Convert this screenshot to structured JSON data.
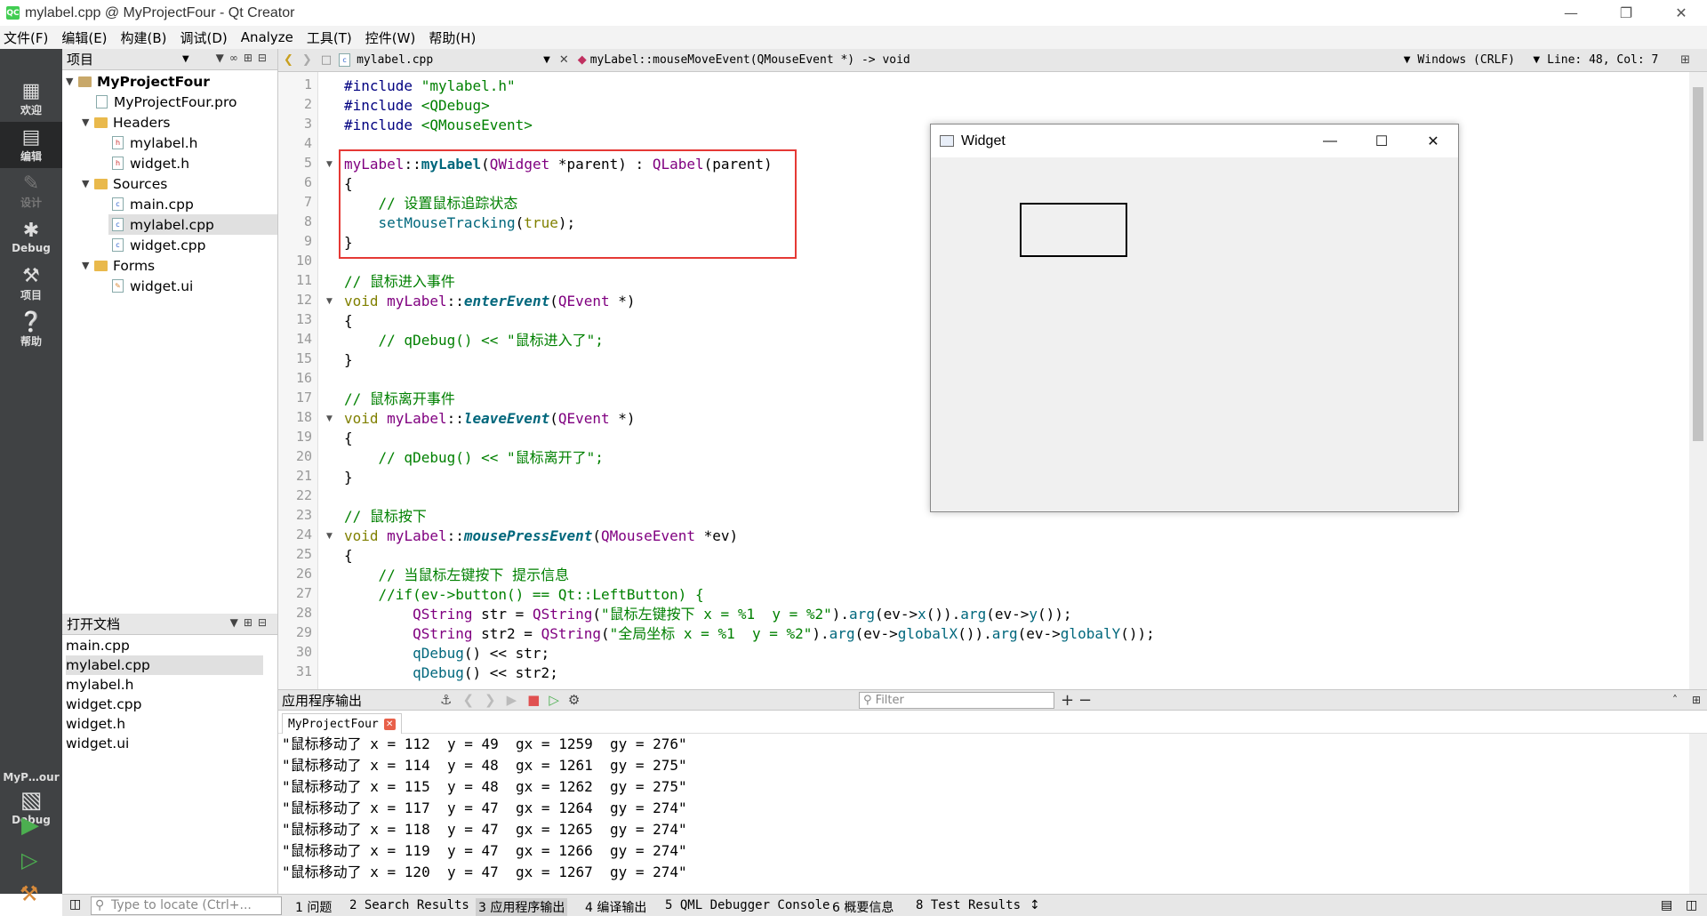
{
  "window": {
    "title": "mylabel.cpp @ MyProjectFour - Qt Creator",
    "logo": "QC"
  },
  "menu": [
    "文件(F)",
    "编辑(E)",
    "构建(B)",
    "调试(D)",
    "Analyze",
    "工具(T)",
    "控件(W)",
    "帮助(H)"
  ],
  "modes": [
    {
      "label": "欢迎",
      "icon": "grid-icon"
    },
    {
      "label": "编辑",
      "icon": "edit-icon"
    },
    {
      "label": "设计",
      "icon": "pencil-icon"
    },
    {
      "label": "Debug",
      "icon": "bug-icon"
    },
    {
      "label": "项目",
      "icon": "wrench-icon"
    },
    {
      "label": "帮助",
      "icon": "help-icon"
    }
  ],
  "kit": {
    "project": "MyP…our",
    "mode": "Debug"
  },
  "project_pane": {
    "title": "项目",
    "tree": [
      {
        "label": "MyProjectFour"
      },
      {
        "label": "MyProjectFour.pro"
      },
      {
        "label": "Headers"
      },
      {
        "label": "mylabel.h"
      },
      {
        "label": "widget.h"
      },
      {
        "label": "Sources"
      },
      {
        "label": "main.cpp"
      },
      {
        "label": "mylabel.cpp"
      },
      {
        "label": "widget.cpp"
      },
      {
        "label": "Forms"
      },
      {
        "label": "widget.ui"
      }
    ]
  },
  "open_docs": {
    "title": "打开文档",
    "files": [
      "main.cpp",
      "mylabel.cpp",
      "mylabel.h",
      "widget.cpp",
      "widget.h",
      "widget.ui"
    ]
  },
  "editor_bar": {
    "file": "mylabel.cpp",
    "symbol": "myLabel::mouseMoveEvent(QMouseEvent *) -> void",
    "encoding": "Windows (CRLF)",
    "position": "Line: 48, Col: 7"
  },
  "code": {
    "l1a": "#include ",
    "l1b": "\"mylabel.h\"",
    "l2a": "#include ",
    "l2b": "<QDebug>",
    "l3a": "#include ",
    "l3b": "<QMouseEvent>",
    "l5": [
      "myLabel",
      "::",
      "myLabel",
      "(",
      "QWidget",
      " *parent) : ",
      "QLabel",
      "(parent)"
    ],
    "l6": "{",
    "l7": "    // 设置鼠标追踪状态",
    "l8a": "    setMouseTracking",
    "l8b": "(",
    "l8c": "true",
    "l8d": ");",
    "l9": "}",
    "l11": "// 鼠标进入事件",
    "l12": [
      "void ",
      "myLabel",
      "::",
      "enterEvent",
      "(",
      "QEvent",
      " *)"
    ],
    "l13": "{",
    "l14": "    // qDebug() << \"鼠标进入了\";",
    "l15": "}",
    "l17": "// 鼠标离开事件",
    "l18": [
      "void ",
      "myLabel",
      "::",
      "leaveEvent",
      "(",
      "QEvent",
      " *)"
    ],
    "l19": "{",
    "l20": "    // qDebug() << \"鼠标离开了\";",
    "l21": "}",
    "l23": "// 鼠标按下",
    "l24": [
      "void ",
      "myLabel",
      "::",
      "mousePressEvent",
      "(",
      "QMouseEvent",
      " *ev)"
    ],
    "l25": "{",
    "l26": "    // 当鼠标左键按下 提示信息",
    "l27": "    //if(ev->button() == Qt::LeftButton) {",
    "l28": [
      "        ",
      "QString",
      " str = ",
      "QString",
      "(",
      "\"鼠标左键按下 x = %1  y = %2\"",
      ").",
      "arg",
      "(ev->",
      "x",
      "()).",
      "arg",
      "(ev->",
      "y",
      "());"
    ],
    "l29": [
      "        ",
      "QString",
      " str2 = ",
      "QString",
      "(",
      "\"全局坐标 x = %1  y = %2\"",
      ").",
      "arg",
      "(ev->",
      "globalX",
      "()).",
      "arg",
      "(ev->",
      "globalY",
      "());"
    ],
    "l30": [
      "        ",
      "qDebug",
      "() << str;"
    ],
    "l31": [
      "        ",
      "qDebug",
      "() << str2;"
    ]
  },
  "widget_window": {
    "title": "Widget"
  },
  "output_pane": {
    "title": "应用程序输出",
    "filter_placeholder": "Filter",
    "tab": "MyProjectFour",
    "lines": [
      "\"鼠标移动了 x = 112  y = 49  gx = 1259  gy = 276\"",
      "\"鼠标移动了 x = 114  y = 48  gx = 1261  gy = 275\"",
      "\"鼠标移动了 x = 115  y = 48  gx = 1262  gy = 275\"",
      "\"鼠标移动了 x = 117  y = 47  gx = 1264  gy = 274\"",
      "\"鼠标移动了 x = 118  y = 47  gx = 1265  gy = 274\"",
      "\"鼠标移动了 x = 119  y = 47  gx = 1266  gy = 274\"",
      "\"鼠标移动了 x = 120  y = 47  gx = 1267  gy = 274\""
    ]
  },
  "status": {
    "locate_placeholder": "Type to locate (Ctrl+...",
    "tabs": [
      "1 问题",
      "2 Search Results",
      "3 应用程序输出",
      "4 编译输出",
      "5 QML Debugger Console",
      "6 概要信息",
      "8 Test Results"
    ]
  }
}
